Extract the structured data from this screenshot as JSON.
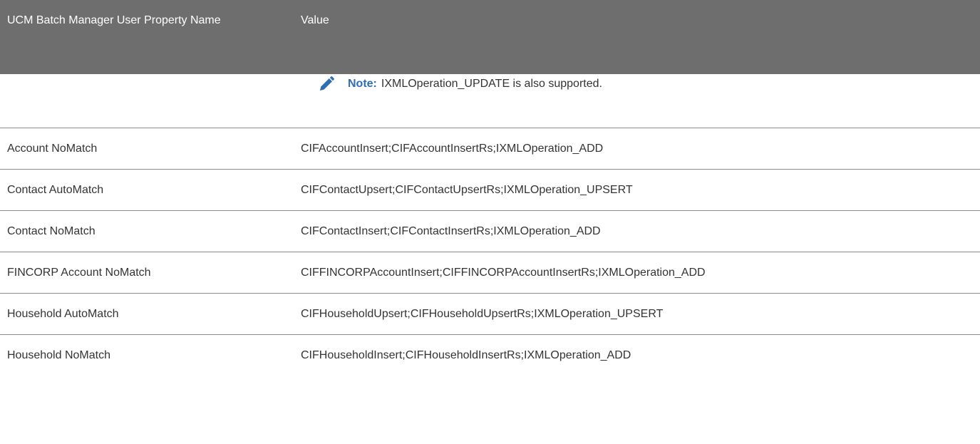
{
  "header": {
    "col1": "UCM Batch Manager User Property Name",
    "col2": "Value"
  },
  "note": {
    "icon": "pencil-icon",
    "label": "Note:",
    "text": "IXMLOperation_UPDATE is also supported.",
    "label_color": "#2f6db5"
  },
  "rows": [
    {
      "name": "Account NoMatch",
      "value": "CIFAccountInsert;CIFAccountInsertRs;IXMLOperation_ADD"
    },
    {
      "name": "Contact AutoMatch",
      "value": "CIFContactUpsert;CIFContactUpsertRs;IXMLOperation_UPSERT"
    },
    {
      "name": "Contact NoMatch",
      "value": "CIFContactInsert;CIFContactInsertRs;IXMLOperation_ADD"
    },
    {
      "name": "FINCORP Account NoMatch",
      "value": "CIFFINCORPAccountInsert;CIFFINCORPAccountInsertRs;IXMLOperation_ADD"
    },
    {
      "name": "Household AutoMatch",
      "value": "CIFHouseholdUpsert;CIFHouseholdUpsertRs;IXMLOperation_UPSERT"
    },
    {
      "name": "Household NoMatch",
      "value": "CIFHouseholdInsert;CIFHouseholdInsertRs;IXMLOperation_ADD"
    }
  ],
  "colors": {
    "header_bg": "#6e6e6e",
    "header_text": "#ffffff",
    "body_text": "#333333",
    "divider": "#8a8a8a"
  }
}
